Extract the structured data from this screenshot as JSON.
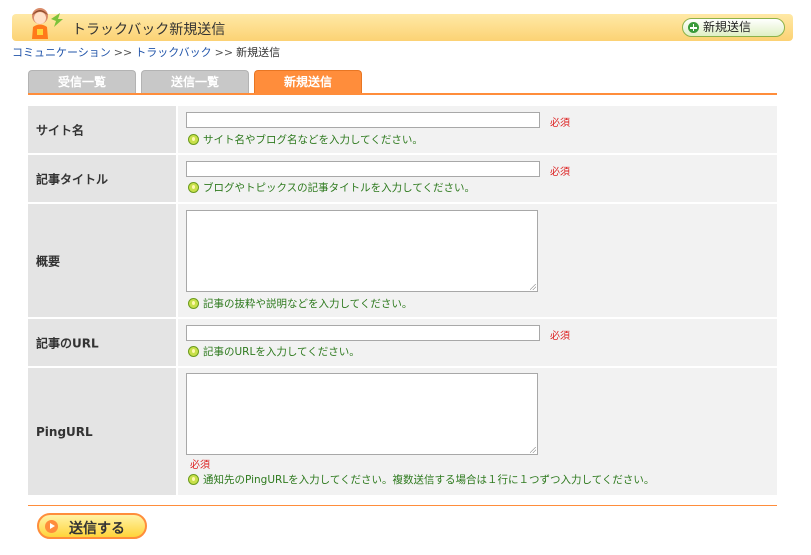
{
  "header": {
    "title": "トラックバック新規送信",
    "new_button_label": "新規送信"
  },
  "breadcrumb": {
    "items": [
      "コミュニケーション",
      "トラックバック",
      "新規送信"
    ],
    "separator": ">>"
  },
  "tabs": [
    {
      "label": "受信一覧",
      "active": false
    },
    {
      "label": "送信一覧",
      "active": false
    },
    {
      "label": "新規送信",
      "active": true
    }
  ],
  "form": {
    "required_label": "必須",
    "fields": [
      {
        "label": "サイト名",
        "value": "",
        "hint": "サイト名やブログ名などを入力してください。"
      },
      {
        "label": "記事タイトル",
        "value": "",
        "hint": "ブログやトピックスの記事タイトルを入力してください。"
      },
      {
        "label": "概要",
        "value": "",
        "hint": "記事の抜粋や説明などを入力してください。"
      },
      {
        "label": "記事のURL",
        "value": "",
        "hint": "記事のURLを入力してください。"
      },
      {
        "label": "PingURL",
        "value": "",
        "hint": "通知先のPingURLを入力してください。複数送信する場合は１行に１つずつ入力してください。"
      }
    ]
  },
  "submit_label": "送信する",
  "colors": {
    "accent": "#ff8d3b",
    "header_bg": "#fcd274",
    "required": "#dd2222",
    "hint": "#2e7a1e"
  }
}
